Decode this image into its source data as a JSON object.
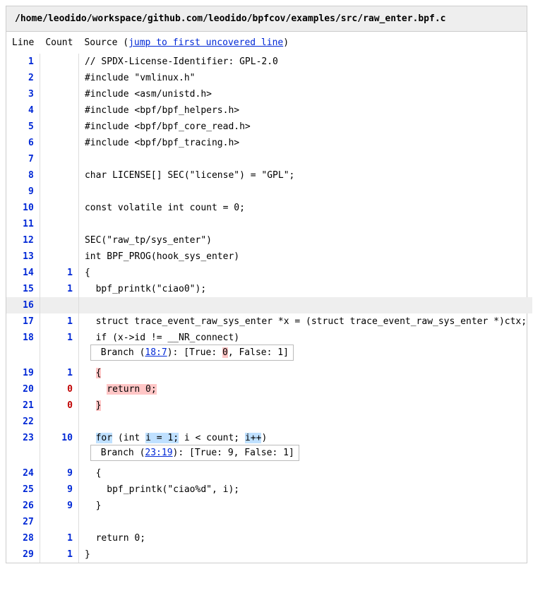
{
  "filepath": "/home/leodido/workspace/github.com/leodido/bpfcov/examples/src/raw_enter.bpf.c",
  "headers": {
    "line": "Line",
    "count": "Count",
    "source_prefix": "Source (",
    "source_link": "jump to first uncovered line",
    "source_suffix": ")"
  },
  "rows": [
    {
      "n": "1",
      "count": "",
      "cls": "",
      "src_plain": "// SPDX-License-Identifier: GPL-2.0"
    },
    {
      "n": "2",
      "count": "",
      "cls": "",
      "src_plain": "#include \"vmlinux.h\""
    },
    {
      "n": "3",
      "count": "",
      "cls": "",
      "src_plain": "#include <asm/unistd.h>"
    },
    {
      "n": "4",
      "count": "",
      "cls": "",
      "src_plain": "#include <bpf/bpf_helpers.h>"
    },
    {
      "n": "5",
      "count": "",
      "cls": "",
      "src_plain": "#include <bpf/bpf_core_read.h>"
    },
    {
      "n": "6",
      "count": "",
      "cls": "",
      "src_plain": "#include <bpf/bpf_tracing.h>"
    },
    {
      "n": "7",
      "count": "",
      "cls": "",
      "src_plain": ""
    },
    {
      "n": "8",
      "count": "",
      "cls": "",
      "src_plain": "char LICENSE[] SEC(\"license\") = \"GPL\";"
    },
    {
      "n": "9",
      "count": "",
      "cls": "",
      "src_plain": ""
    },
    {
      "n": "10",
      "count": "",
      "cls": "",
      "src_plain": "const volatile int count = 0;"
    },
    {
      "n": "11",
      "count": "",
      "cls": "",
      "src_plain": ""
    },
    {
      "n": "12",
      "count": "",
      "cls": "",
      "src_plain": "SEC(\"raw_tp/sys_enter\")"
    },
    {
      "n": "13",
      "count": "",
      "cls": "",
      "src_plain": "int BPF_PROG(hook_sys_enter)"
    },
    {
      "n": "14",
      "count": "1",
      "cls": "covered",
      "src_plain": "{"
    },
    {
      "n": "15",
      "count": "1",
      "cls": "covered",
      "src_plain": "  bpf_printk(\"ciao0\");"
    },
    {
      "n": "16",
      "count": "",
      "cls": "",
      "row": "uncov-row",
      "src_plain": ""
    },
    {
      "n": "17",
      "count": "1",
      "cls": "covered",
      "src_plain": "  struct trace_event_raw_sys_enter *x = (struct trace_event_raw_sys_enter *)ctx;"
    },
    {
      "n": "18",
      "count": "1",
      "cls": "covered",
      "src_plain": "  if (x->id != __NR_connect)",
      "branch": {
        "loc": "18:7",
        "parts": [
          {
            "t": "True: ",
            "hl": ""
          },
          {
            "t": "0",
            "hl": "hl-red"
          },
          {
            "t": ", False: ",
            "hl": ""
          },
          {
            "t": "1",
            "hl": ""
          }
        ]
      }
    },
    {
      "n": "19",
      "count": "1",
      "cls": "covered",
      "spans": [
        {
          "t": "  ",
          "hl": ""
        },
        {
          "t": "{",
          "hl": "hl-red"
        }
      ]
    },
    {
      "n": "20",
      "count": "0",
      "cls": "uncov",
      "spans": [
        {
          "t": "    ",
          "hl": ""
        },
        {
          "t": "return 0;",
          "hl": "hl-red"
        }
      ]
    },
    {
      "n": "21",
      "count": "0",
      "cls": "uncov",
      "spans": [
        {
          "t": "  ",
          "hl": ""
        },
        {
          "t": "}",
          "hl": "hl-red"
        }
      ]
    },
    {
      "n": "22",
      "count": "",
      "cls": "",
      "src_plain": ""
    },
    {
      "n": "23",
      "count": "10",
      "cls": "covered",
      "spans": [
        {
          "t": "  ",
          "hl": ""
        },
        {
          "t": "for",
          "hl": "hl-blue"
        },
        {
          "t": " (int ",
          "hl": ""
        },
        {
          "t": "i = 1;",
          "hl": "hl-blue"
        },
        {
          "t": " i < count; ",
          "hl": ""
        },
        {
          "t": "i++",
          "hl": "hl-blue"
        },
        {
          "t": ")",
          "hl": ""
        }
      ],
      "branch": {
        "loc": "23:19",
        "parts": [
          {
            "t": "True: ",
            "hl": ""
          },
          {
            "t": "9",
            "hl": ""
          },
          {
            "t": ", False: ",
            "hl": ""
          },
          {
            "t": "1",
            "hl": ""
          }
        ]
      }
    },
    {
      "n": "24",
      "count": "9",
      "cls": "covered",
      "src_plain": "  {"
    },
    {
      "n": "25",
      "count": "9",
      "cls": "covered",
      "src_plain": "    bpf_printk(\"ciao%d\", i);"
    },
    {
      "n": "26",
      "count": "9",
      "cls": "covered",
      "src_plain": "  }"
    },
    {
      "n": "27",
      "count": "",
      "cls": "",
      "src_plain": ""
    },
    {
      "n": "28",
      "count": "1",
      "cls": "covered",
      "src_plain": "  return 0;"
    },
    {
      "n": "29",
      "count": "1",
      "cls": "covered",
      "src_plain": "}"
    }
  ],
  "branch_label": "Branch"
}
